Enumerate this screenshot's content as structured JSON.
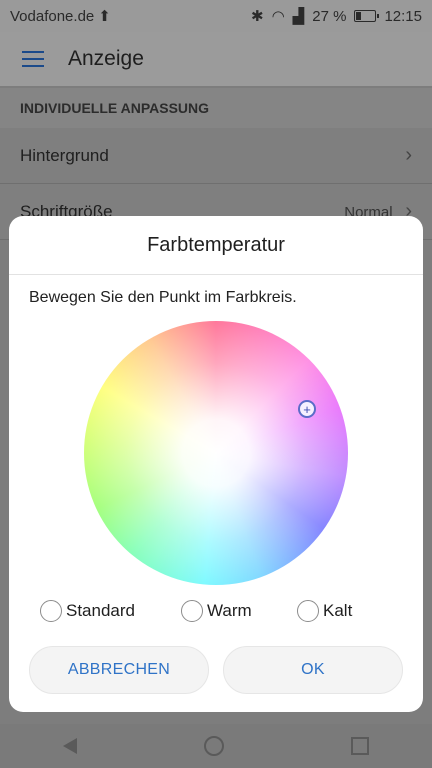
{
  "status_bar": {
    "carrier": "Vodafone.de",
    "upload_icon": "upload-arrow-icon",
    "icons": [
      "bluetooth-icon",
      "wifi-icon",
      "signal-icon"
    ],
    "battery": "27 %",
    "time": "12:15"
  },
  "app_bar": {
    "menu_icon": "hamburger-menu-icon",
    "title": "Anzeige"
  },
  "section": {
    "header": "INDIVIDUELLE ANPASSUNG"
  },
  "settings": {
    "items": [
      {
        "label": "Hintergrund",
        "value": ""
      },
      {
        "label": "Schriftgröße",
        "value": "Normal"
      }
    ]
  },
  "dialog": {
    "title": "Farbtemperatur",
    "message": "Bewegen Sie den Punkt im Farbkreis.",
    "marker_symbol": "+",
    "options": [
      {
        "label": "Standard",
        "selected": false
      },
      {
        "label": "Warm",
        "selected": false
      },
      {
        "label": "Kalt",
        "selected": false
      }
    ],
    "cancel": "ABBRECHEN",
    "ok": "OK",
    "accent_color": "#2f73c7"
  },
  "nav_bar": {
    "icons": [
      "back-icon",
      "home-icon",
      "recent-apps-icon"
    ]
  }
}
